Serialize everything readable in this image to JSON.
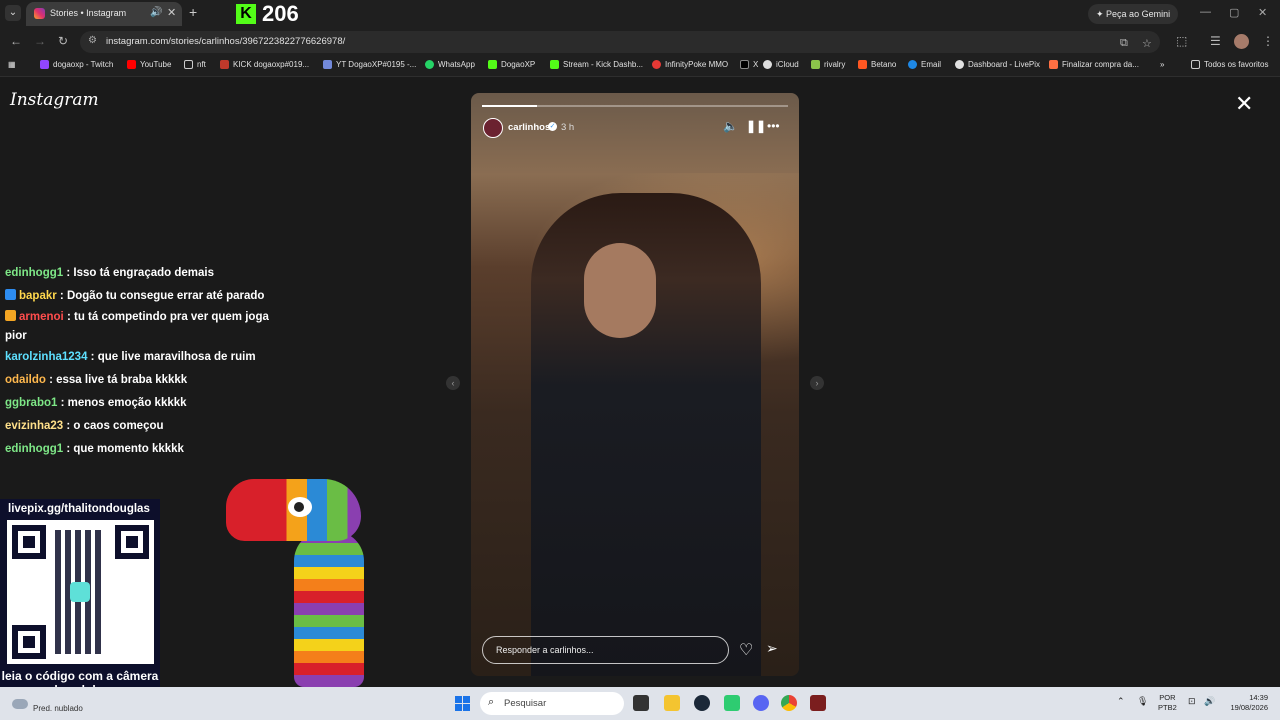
{
  "browser": {
    "tab_title": "Stories • Instagram",
    "url": "instagram.com/stories/carlinhos/3967223822776626978/",
    "gemini_label": "Peça ao Gemini",
    "bookmarks": [
      "dogaoxp - Twitch",
      "YouTube",
      "nft",
      "KICK dogaoxp#019...",
      "YT DogaoXP#0195 -...",
      "WhatsApp",
      "DogaoXP",
      "Stream - Kick Dashb...",
      "InfinityPoke MMO",
      "X",
      "iCloud",
      "rivalry",
      "Betano",
      "Email",
      "Dashboard - LivePix",
      "Finalizar compra da..."
    ],
    "all_bookmarks": "Todos os favoritos",
    "colors": {
      "bg": "#1f1f1f",
      "kick_green": "#53fc18"
    }
  },
  "kick": {
    "viewer_count": "206"
  },
  "instagram": {
    "logo": "Instagram",
    "story": {
      "username": "carlinhos",
      "time": "3 h",
      "reply_placeholder": "Responder a carlinhos...",
      "progress": 0.18
    }
  },
  "chat": [
    {
      "user": "edinhogg1",
      "text": "Isso tá engraçado demais",
      "color": "#7ee787",
      "badge": ""
    },
    {
      "user": "bapakr",
      "text": "Dogão tu consegue errar até parado",
      "color": "#ffd84d",
      "badge": "#2d8cf0"
    },
    {
      "user": "armenoi",
      "text": "tu tá competindo pra ver quem joga pior",
      "color": "#ff4d4d",
      "badge": "#f5a623"
    },
    {
      "user": "karolzinha1234",
      "text": "que live maravilhosa de ruim",
      "color": "#5ee0ff",
      "badge": ""
    },
    {
      "user": "odaildo",
      "text": "essa live tá braba kkkkk",
      "color": "#ffb84d",
      "badge": ""
    },
    {
      "user": "ggbrabo1",
      "text": "menos emoção kkkkk",
      "color": "#7ee787",
      "badge": ""
    },
    {
      "user": "evizinha23",
      "text": "o caos começou",
      "color": "#ffe08a",
      "badge": ""
    },
    {
      "user": "edinhogg1",
      "text": "que momento kkkkk",
      "color": "#7ee787",
      "badge": ""
    }
  ],
  "qr": {
    "url": "livepix.gg/thalitondouglas",
    "caption": "leia o código com a câmera do celular."
  },
  "taskbar": {
    "weather": "Pred. nublado",
    "search_placeholder": "Pesquisar",
    "lang_line1": "POR",
    "lang_line2": "PTB2",
    "time": "14:39",
    "date": "19/08/2026"
  }
}
